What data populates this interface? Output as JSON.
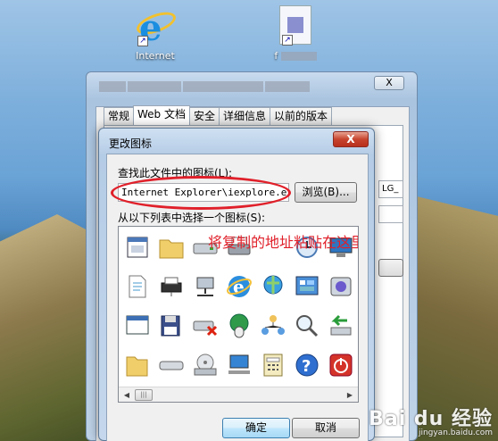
{
  "desktop": {
    "icons": [
      {
        "label": "Internet",
        "name": "internet-explorer"
      },
      {
        "label": "f",
        "name": "file"
      }
    ]
  },
  "properties_window": {
    "close_glyph": "X",
    "tabs": [
      {
        "label": "常规",
        "active": false
      },
      {
        "label": "Web 文档",
        "active": true
      },
      {
        "label": "安全",
        "active": false
      },
      {
        "label": "详细信息",
        "active": false
      },
      {
        "label": "以前的版本",
        "active": false
      }
    ],
    "side_field_text": "LG_"
  },
  "change_icon_dialog": {
    "title": "更改图标",
    "close_glyph": "X",
    "find_label": "查找此文件中的图标(L):",
    "path_value": "Internet Explorer\\iexplore.exe",
    "browse_label": "浏览(B)...",
    "list_label": "从以下列表中选择一个图标(S):",
    "ok_label": "确定",
    "cancel_label": "取消",
    "annotation": "将复制的地址粘贴在这里",
    "icons": [
      "window-app-icon",
      "folder-icon",
      "drive-icon",
      "printer-icon",
      "clock-icon",
      "monitor-icon",
      "document-icon",
      "printer-network-icon",
      "network-computer-icon",
      "ie-globe-icon",
      "globe-network-icon",
      "control-panel-icon",
      "film-icon",
      "window-blank-icon",
      "floppy-icon",
      "drive-error-icon",
      "mouse-globe-icon",
      "network-users-icon",
      "magnifier-icon",
      "arrow-drive-icon",
      "folder-open-icon",
      "drive-flat-icon",
      "cd-drive-icon",
      "computer-net-icon",
      "calculator-icon",
      "help-icon",
      "power-icon"
    ]
  },
  "watermark": {
    "big": "Bai du 经验",
    "small": "jingyan.baidu.com"
  },
  "colors": {
    "annotation": "#e0202a",
    "close_button": "#c7442e",
    "title_bar": "#b5cce6"
  }
}
